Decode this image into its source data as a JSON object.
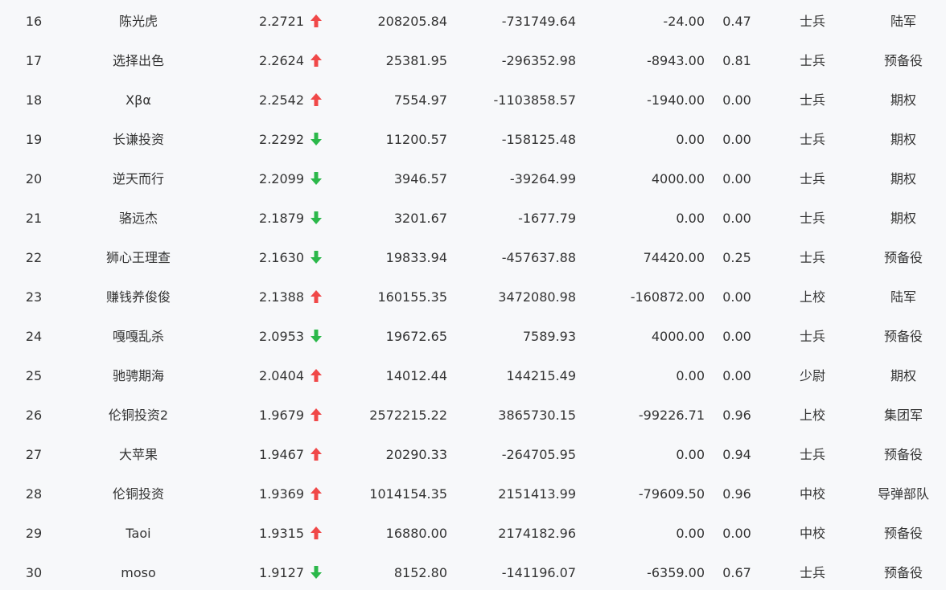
{
  "colors": {
    "background": "#f7f8fa",
    "text": "#333333",
    "up": "#f04848",
    "down": "#2bb84a"
  },
  "rows": [
    {
      "rank": "16",
      "name": "陈光虎",
      "score": "2.2721",
      "trend": "up",
      "equity": "208205.84",
      "profit": "-731749.64",
      "flow": "-24.00",
      "ratio": "0.47",
      "level": "士兵",
      "group": "陆军"
    },
    {
      "rank": "17",
      "name": "选择出色",
      "score": "2.2624",
      "trend": "up",
      "equity": "25381.95",
      "profit": "-296352.98",
      "flow": "-8943.00",
      "ratio": "0.81",
      "level": "士兵",
      "group": "预备役"
    },
    {
      "rank": "18",
      "name": "Xβα",
      "score": "2.2542",
      "trend": "up",
      "equity": "7554.97",
      "profit": "-1103858.57",
      "flow": "-1940.00",
      "ratio": "0.00",
      "level": "士兵",
      "group": "期权"
    },
    {
      "rank": "19",
      "name": "长谦投资",
      "score": "2.2292",
      "trend": "down",
      "equity": "11200.57",
      "profit": "-158125.48",
      "flow": "0.00",
      "ratio": "0.00",
      "level": "士兵",
      "group": "期权"
    },
    {
      "rank": "20",
      "name": "逆天而行",
      "score": "2.2099",
      "trend": "down",
      "equity": "3946.57",
      "profit": "-39264.99",
      "flow": "4000.00",
      "ratio": "0.00",
      "level": "士兵",
      "group": "期权"
    },
    {
      "rank": "21",
      "name": "骆远杰",
      "score": "2.1879",
      "trend": "down",
      "equity": "3201.67",
      "profit": "-1677.79",
      "flow": "0.00",
      "ratio": "0.00",
      "level": "士兵",
      "group": "期权"
    },
    {
      "rank": "22",
      "name": "狮心王理查",
      "score": "2.1630",
      "trend": "down",
      "equity": "19833.94",
      "profit": "-457637.88",
      "flow": "74420.00",
      "ratio": "0.25",
      "level": "士兵",
      "group": "预备役"
    },
    {
      "rank": "23",
      "name": "赚钱养俊俊",
      "score": "2.1388",
      "trend": "up",
      "equity": "160155.35",
      "profit": "3472080.98",
      "flow": "-160872.00",
      "ratio": "0.00",
      "level": "上校",
      "group": "陆军"
    },
    {
      "rank": "24",
      "name": "嘎嘎乱杀",
      "score": "2.0953",
      "trend": "down",
      "equity": "19672.65",
      "profit": "7589.93",
      "flow": "4000.00",
      "ratio": "0.00",
      "level": "士兵",
      "group": "预备役"
    },
    {
      "rank": "25",
      "name": "驰骋期海",
      "score": "2.0404",
      "trend": "up",
      "equity": "14012.44",
      "profit": "144215.49",
      "flow": "0.00",
      "ratio": "0.00",
      "level": "少尉",
      "group": "期权"
    },
    {
      "rank": "26",
      "name": "伦铜投资2",
      "score": "1.9679",
      "trend": "up",
      "equity": "2572215.22",
      "profit": "3865730.15",
      "flow": "-99226.71",
      "ratio": "0.96",
      "level": "上校",
      "group": "集团军"
    },
    {
      "rank": "27",
      "name": "大苹果",
      "score": "1.9467",
      "trend": "up",
      "equity": "20290.33",
      "profit": "-264705.95",
      "flow": "0.00",
      "ratio": "0.94",
      "level": "士兵",
      "group": "预备役"
    },
    {
      "rank": "28",
      "name": "伦铜投资",
      "score": "1.9369",
      "trend": "up",
      "equity": "1014154.35",
      "profit": "2151413.99",
      "flow": "-79609.50",
      "ratio": "0.96",
      "level": "中校",
      "group": "导弹部队"
    },
    {
      "rank": "29",
      "name": "Taoi",
      "score": "1.9315",
      "trend": "up",
      "equity": "16880.00",
      "profit": "2174182.96",
      "flow": "0.00",
      "ratio": "0.00",
      "level": "中校",
      "group": "预备役"
    },
    {
      "rank": "30",
      "name": "moso",
      "score": "1.9127",
      "trend": "down",
      "equity": "8152.80",
      "profit": "-141196.07",
      "flow": "-6359.00",
      "ratio": "0.67",
      "level": "士兵",
      "group": "预备役"
    }
  ]
}
